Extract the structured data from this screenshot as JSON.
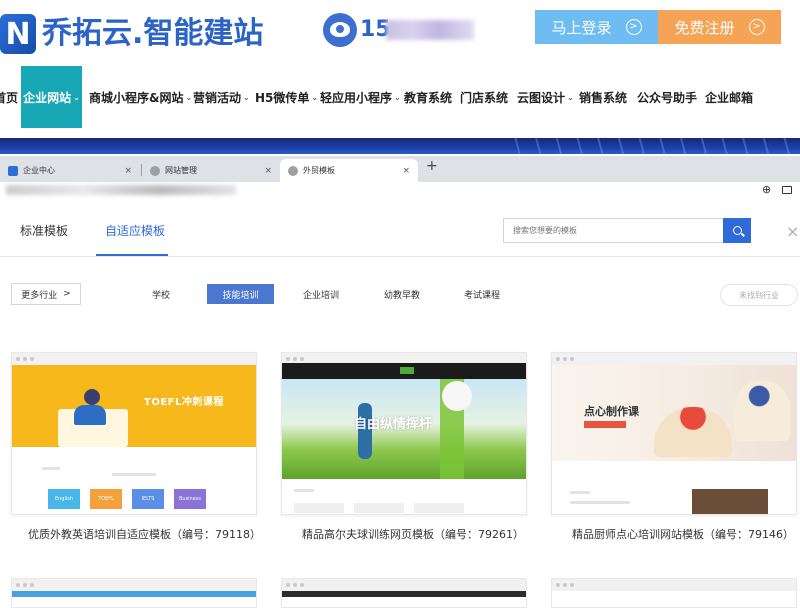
{
  "brand": {
    "logo_letter": "N",
    "name": "乔拓云.智能建站"
  },
  "contact": {
    "phone_prefix": "15"
  },
  "auth": {
    "login_label": "马上登录",
    "register_label": "免费注册",
    "arrow": ">"
  },
  "nav": {
    "items": [
      {
        "label": "首页",
        "dropdown": false,
        "active": false
      },
      {
        "label": "企业网站",
        "dropdown": true,
        "active": true
      },
      {
        "label": "商城小程序&网站",
        "dropdown": true,
        "active": false
      },
      {
        "label": "营销活动",
        "dropdown": true,
        "active": false
      },
      {
        "label": "H5微传单",
        "dropdown": true,
        "active": false
      },
      {
        "label": "轻应用小程序",
        "dropdown": true,
        "active": false
      },
      {
        "label": "教育系统",
        "dropdown": false,
        "active": false
      },
      {
        "label": "门店系统",
        "dropdown": false,
        "active": false
      },
      {
        "label": "云图设计",
        "dropdown": true,
        "active": false
      },
      {
        "label": "销售系统",
        "dropdown": false,
        "active": false
      },
      {
        "label": "公众号助手",
        "dropdown": false,
        "active": false
      },
      {
        "label": "企业邮箱",
        "dropdown": false,
        "active": false
      }
    ],
    "caret": "⌄"
  },
  "browser": {
    "tabs": [
      {
        "label": "企业中心",
        "close": "×"
      },
      {
        "label": "网站管理",
        "close": "×"
      },
      {
        "label": "外贸模板",
        "close": "×"
      }
    ],
    "new_tab": "+",
    "zoom_icon": "⊕"
  },
  "panel": {
    "tabs": [
      {
        "label": "标准模板"
      },
      {
        "label": "自适应模板"
      }
    ],
    "active_tab": 1,
    "search_placeholder": "搜索您想要的模板",
    "close": "×",
    "more_industry": "更多行业",
    "more_arrow": ">",
    "categories": [
      {
        "label": "学校",
        "active": false
      },
      {
        "label": "技能培训",
        "active": true
      },
      {
        "label": "企业培训",
        "active": false
      },
      {
        "label": "幼教早教",
        "active": false
      },
      {
        "label": "考试课程",
        "active": false
      }
    ],
    "not_found_label": "未找到行业"
  },
  "templates": [
    {
      "title": "优质外教英语培训自适应模板（编号：79118）",
      "hero_text": "TOEFL冲刺课程",
      "tiles": [
        {
          "label": "English",
          "color": "#47b6e8"
        },
        {
          "label": "TOEFL",
          "color": "#f3a23b"
        },
        {
          "label": "IELTS",
          "color": "#5b8ee6"
        },
        {
          "label": "Business",
          "color": "#8a73d6"
        }
      ]
    },
    {
      "title": "精品高尔夫球训练网页模板（编号：79261）",
      "hero_text": "自由纵情挥杆"
    },
    {
      "title": "精品厨师点心培训网站模板（编号：79146）",
      "hero_text": "点心制作课"
    }
  ],
  "colors": {
    "brand_blue": "#2b63c6",
    "nav_active": "#18a7b5",
    "login": "#6fbcf2",
    "register": "#f5a354",
    "accent": "#2e6bd9"
  }
}
